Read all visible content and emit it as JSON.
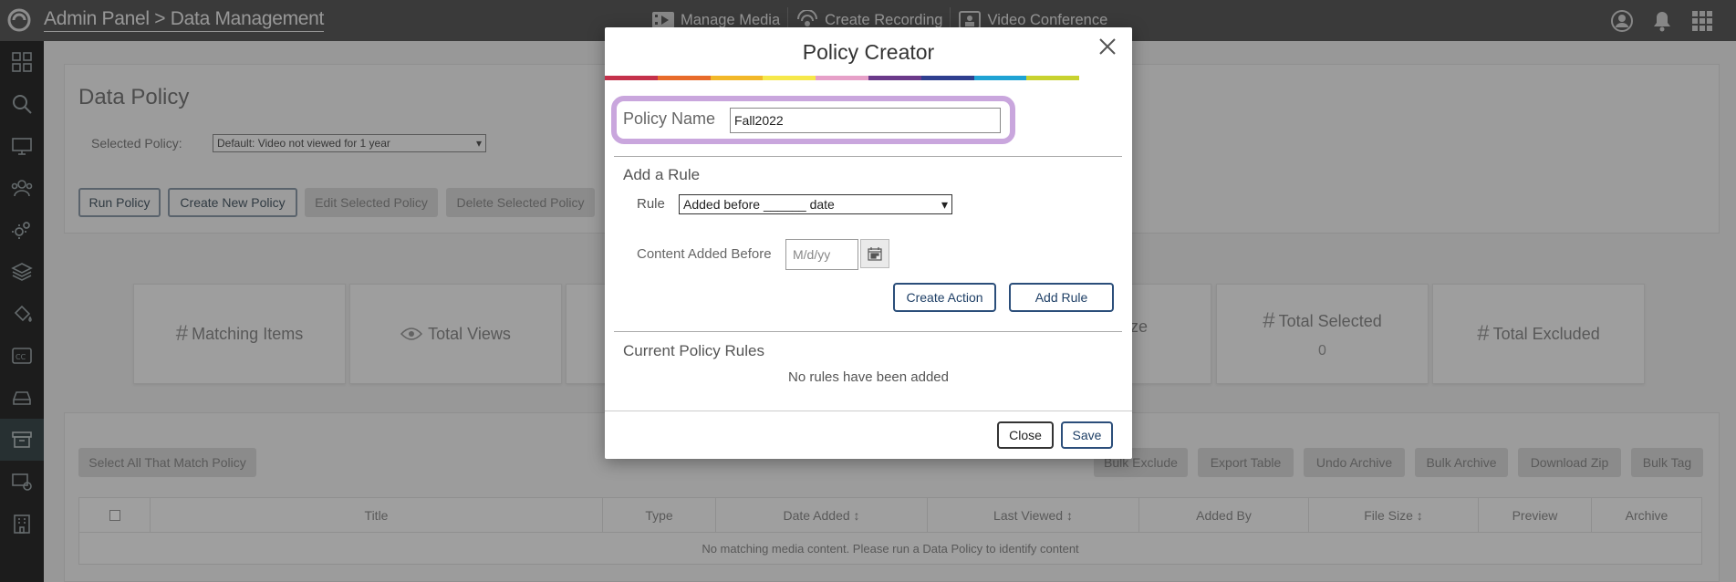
{
  "header": {
    "title": "Admin Panel > Data Management",
    "nav": [
      {
        "label": "Manage Media",
        "icon": "film-icon"
      },
      {
        "label": "Create Recording",
        "icon": "broadcast-icon"
      },
      {
        "label": "Video Conference",
        "icon": "video-conference-icon"
      }
    ],
    "right_icons": [
      "user-icon",
      "bell-icon",
      "apps-grid-icon"
    ]
  },
  "sidebar": {
    "items": [
      {
        "icon": "dashboard-icon"
      },
      {
        "icon": "search-icon"
      },
      {
        "icon": "monitor-icon"
      },
      {
        "icon": "users-icon"
      },
      {
        "icon": "settings-icon"
      },
      {
        "icon": "layers-icon"
      },
      {
        "icon": "paint-bucket-icon"
      },
      {
        "icon": "closed-caption-icon"
      },
      {
        "icon": "drive-icon"
      },
      {
        "icon": "archive-icon",
        "active": true
      },
      {
        "icon": "screen-share-icon"
      },
      {
        "icon": "building-icon"
      }
    ]
  },
  "data_policy": {
    "title": "Data Policy",
    "selected_policy_label": "Selected Policy:",
    "selected_policy_value": "Default: Video not viewed for 1 year",
    "buttons": {
      "run": "Run Policy",
      "create": "Create New Policy",
      "edit": "Edit Selected Policy",
      "delete": "Delete Selected Policy"
    }
  },
  "stats": [
    {
      "label": "Matching Items",
      "icon": "#",
      "value": ""
    },
    {
      "label": "Total Views",
      "icon": "eye",
      "value": ""
    },
    {
      "label": "",
      "icon": "",
      "value": ""
    },
    {
      "label": "ze",
      "icon": "",
      "value": ""
    },
    {
      "label": "Total Selected",
      "icon": "#",
      "value": "0"
    },
    {
      "label": "Total Excluded",
      "icon": "#",
      "value": ""
    }
  ],
  "table_actions": {
    "select_all": "Select All That Match Policy",
    "bulk_exclude": "Bulk Exclude",
    "export": "Export Table",
    "undo_archive": "Undo Archive",
    "bulk_archive": "Bulk Archive",
    "download_zip": "Download Zip",
    "bulk_tag": "Bulk Tag"
  },
  "table": {
    "columns": [
      "",
      "Title",
      "Type",
      "Date Added ↕",
      "Last Viewed ↕",
      "Added By",
      "File Size ↕",
      "Preview",
      "Archive"
    ],
    "empty_message": "No matching media content. Please run a Data Policy to identify content"
  },
  "modal": {
    "title": "Policy Creator",
    "policy_name_label": "Policy Name",
    "policy_name_value": "Fall2022",
    "add_rule_title": "Add a Rule",
    "rule_label": "Rule",
    "rule_value": "Added before ______ date",
    "content_added_label": "Content Added Before",
    "date_placeholder": "M/d/yy",
    "create_action": "Create Action",
    "add_rule": "Add Rule",
    "current_rules_title": "Current Policy Rules",
    "no_rules": "No rules have been added",
    "close": "Close",
    "save": "Save",
    "stripe_colors": [
      "#c4314b",
      "#e86b2b",
      "#f2b829",
      "#f6e84a",
      "#e6a0c8",
      "#6b3a8a",
      "#2f3f8f",
      "#1fa3d4",
      "#c8d22f",
      "#ffffff"
    ]
  }
}
